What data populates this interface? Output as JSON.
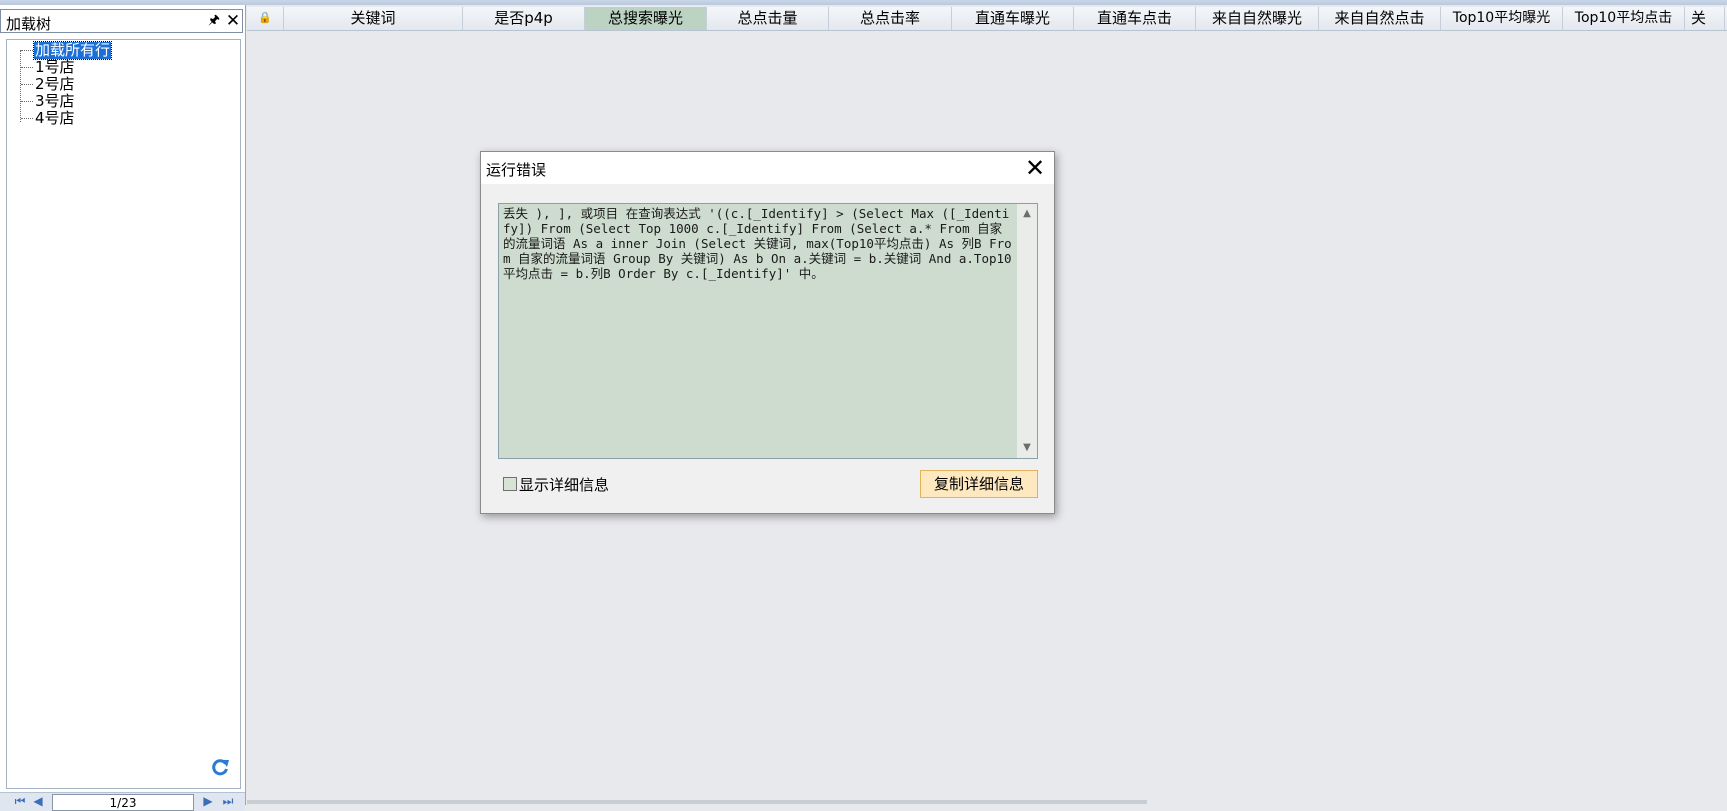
{
  "left_panel": {
    "title": "加载树",
    "tree": {
      "root": "加载所有行",
      "items": [
        "1号店",
        "2号店",
        "3号店",
        "4号店"
      ]
    },
    "pager": {
      "first": "⏮",
      "prev": "◀",
      "page_text": "1/23",
      "next": "▶",
      "last": "⏭"
    }
  },
  "grid": {
    "columns": [
      "关键词",
      "是否p4p",
      "总搜索曝光",
      "总点击量",
      "总点击率",
      "直通车曝光",
      "直通车点击",
      "来自自然曝光",
      "来自自然点击",
      "Top10平均曝光",
      "Top10平均点击",
      "关"
    ],
    "active_column": "总搜索曝光"
  },
  "dialog": {
    "title": "运行错误",
    "message": "丢失 ), ], 或项目 在查询表达式 '((c.[_Identify] > (Select Max ([_Identify]) From (Select Top 1000 c.[_Identify] From (Select a.* From 自家的流量词语 As a inner Join (Select 关键词, max(Top10平均点击) As 列B From 自家的流量词语 Group By 关键词) As b On a.关键词 = b.关键词 And a.Top10平均点击 = b.列B Order By c.[_Identify]' 中。",
    "show_details_label": "显示详细信息",
    "show_details_checked": false,
    "copy_button": "复制详细信息"
  },
  "colors": {
    "selection": "#1c6fd6",
    "message_bg": "#cddccf",
    "active_column_bg": "#bcd3c4",
    "copy_button_bg": "#fde8bf"
  }
}
